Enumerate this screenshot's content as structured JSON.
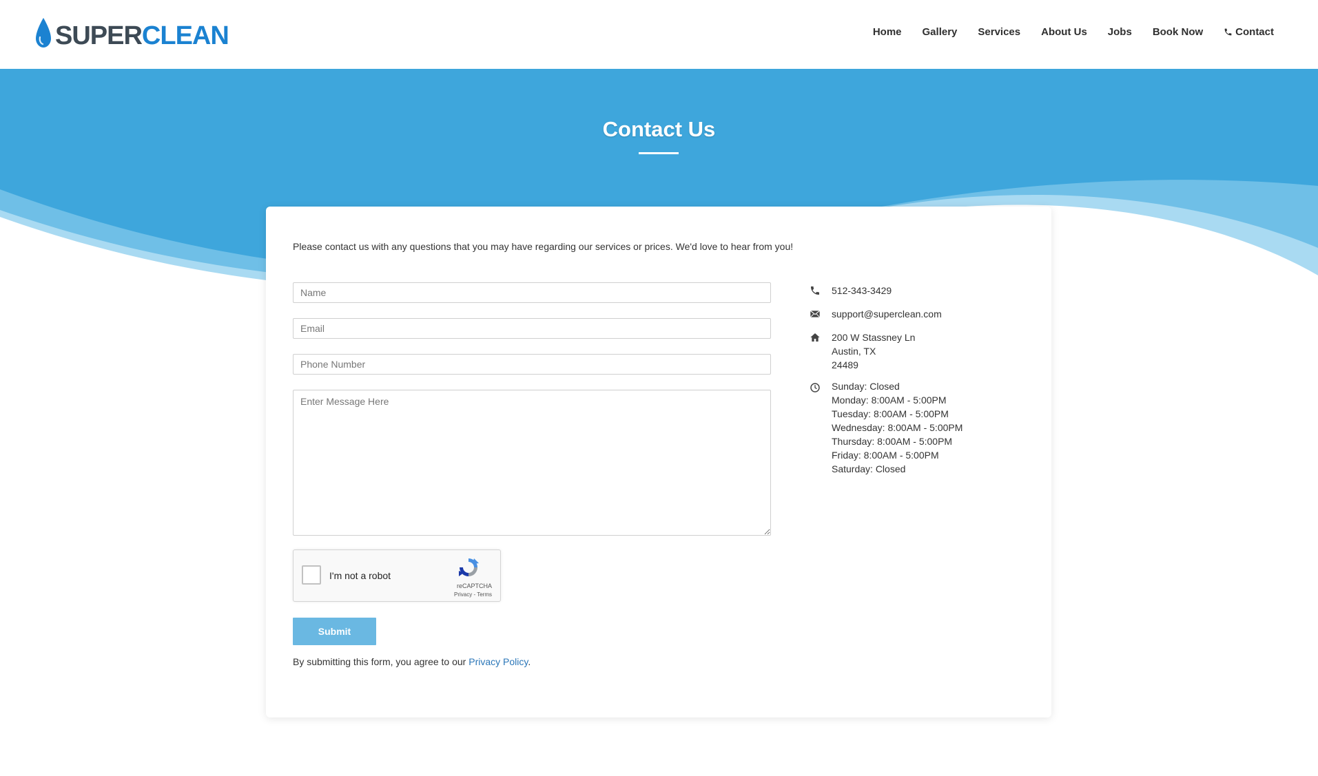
{
  "brand": {
    "part1": "SUPER",
    "part2": "CLEAN"
  },
  "nav": [
    {
      "label": "Home"
    },
    {
      "label": "Gallery"
    },
    {
      "label": "Services"
    },
    {
      "label": "About Us"
    },
    {
      "label": "Jobs"
    },
    {
      "label": "Book Now"
    },
    {
      "label": "Contact"
    }
  ],
  "hero": {
    "title": "Contact Us"
  },
  "intro": "Please contact us with any questions that you may have regarding our services or prices. We'd love to hear from you!",
  "form": {
    "name_placeholder": "Name",
    "email_placeholder": "Email",
    "phone_placeholder": "Phone Number",
    "message_placeholder": "Enter Message Here",
    "submit_label": "Submit"
  },
  "recaptcha": {
    "label": "I'm not a robot",
    "brand": "reCAPTCHA",
    "links": "Privacy - Terms"
  },
  "agreement": {
    "text": "By submitting this form, you agree to our ",
    "link": "Privacy Policy",
    "end": "."
  },
  "contact": {
    "phone": "512-343-3429",
    "email": "support@superclean.com",
    "address": [
      "200 W Stassney Ln",
      "Austin, TX",
      "24489"
    ],
    "hours": [
      "Sunday: Closed",
      "Monday: 8:00AM - 5:00PM",
      "Tuesday: 8:00AM - 5:00PM",
      "Wednesday: 8:00AM - 5:00PM",
      "Thursday: 8:00AM - 5:00PM",
      "Friday: 8:00AM - 5:00PM",
      "Saturday: Closed"
    ]
  },
  "colors": {
    "brand_dark": "#3d4a55",
    "brand_blue": "#1b82d1",
    "hero_blue": "#3ea6dc",
    "submit_blue": "#6ab8e2",
    "link_blue": "#2a76b8"
  },
  "icons": {
    "logo": "water-drop-icon",
    "nav_contact": "phone-icon",
    "phone": "phone-icon",
    "email": "envelope-icon",
    "address": "home-icon",
    "hours": "clock-icon"
  }
}
